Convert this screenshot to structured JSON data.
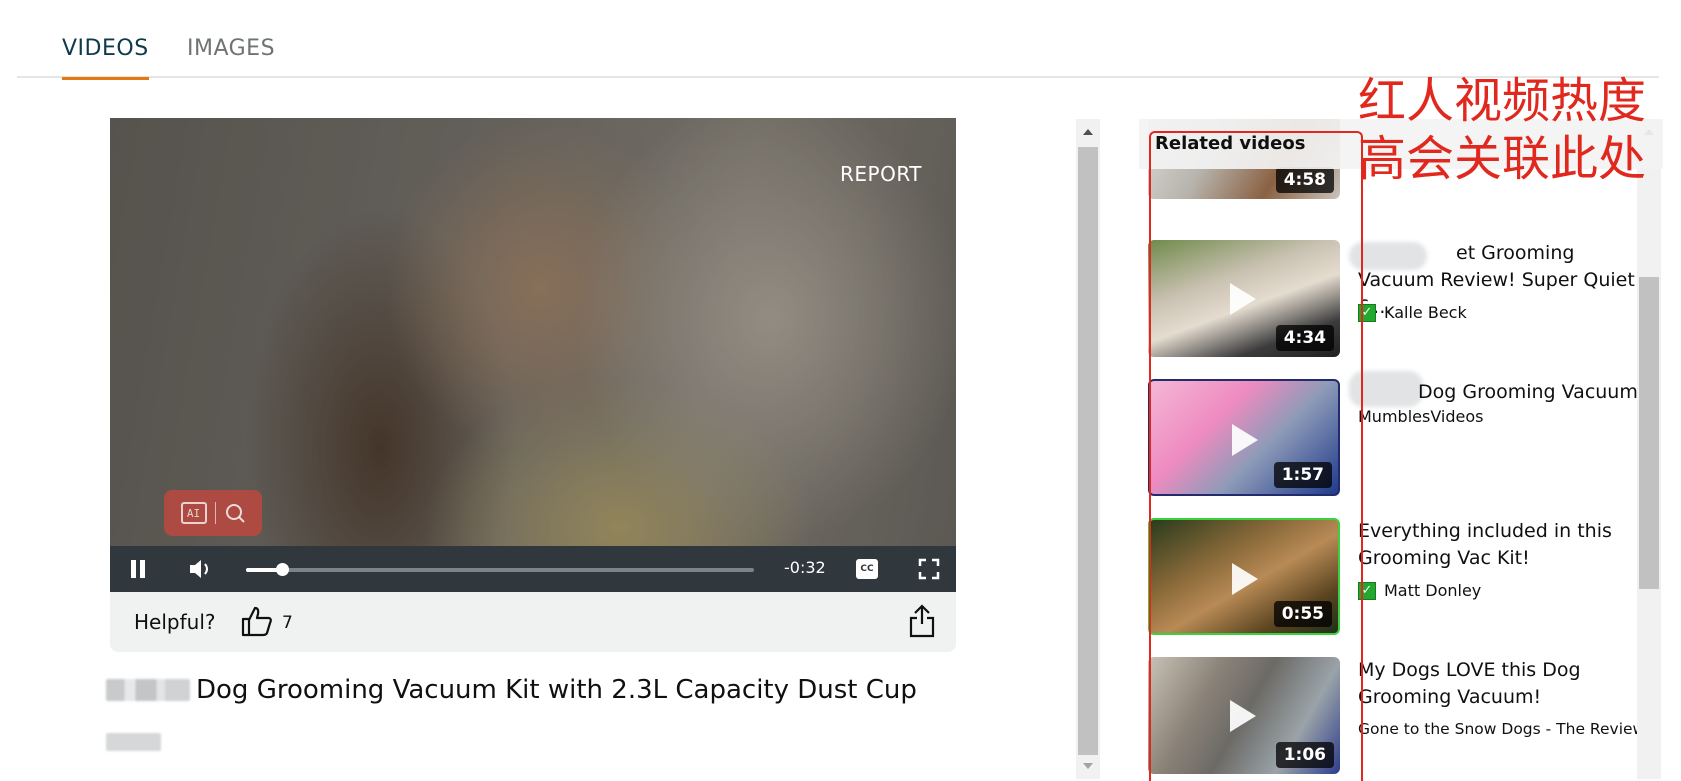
{
  "tabs": [
    {
      "label": "VIDEOS",
      "active": true
    },
    {
      "label": "IMAGES",
      "active": false
    }
  ],
  "player": {
    "report_label": "REPORT",
    "time_remaining": "-0:32",
    "cc_label": "CC",
    "progress_fraction": 0.07
  },
  "helpful": {
    "label": "Helpful?",
    "count": "7"
  },
  "video": {
    "title": "Dog Grooming Vacuum Kit with 2.3L Capacity Dust Cup"
  },
  "related": {
    "title": "Related videos",
    "items": [
      {
        "title": "",
        "author": "",
        "duration": "4:58",
        "verified": false
      },
      {
        "title": "et Grooming Vacuum Review! Super Quiet &…",
        "author": "Kalle Beck",
        "duration": "4:34",
        "verified": true
      },
      {
        "title": "Dog Grooming Vacuum",
        "author": "MumblesVideos",
        "duration": "1:57",
        "verified": false
      },
      {
        "title": "Everything included in this Grooming Vac Kit!",
        "author": "Matt Donley",
        "duration": "0:55",
        "verified": true
      },
      {
        "title": "My Dogs LOVE this Dog Grooming Vacuum!",
        "author": "Gone to the Snow Dogs - The Review",
        "duration": "1:06",
        "verified": false
      }
    ]
  },
  "annotation": {
    "line1": "红人视频热度",
    "line2": "高会关联此处",
    "color": "#e0281e"
  },
  "colors": {
    "accent_tab": "#e47911",
    "control_bar": "#31383d",
    "verified": "#22a82f"
  }
}
